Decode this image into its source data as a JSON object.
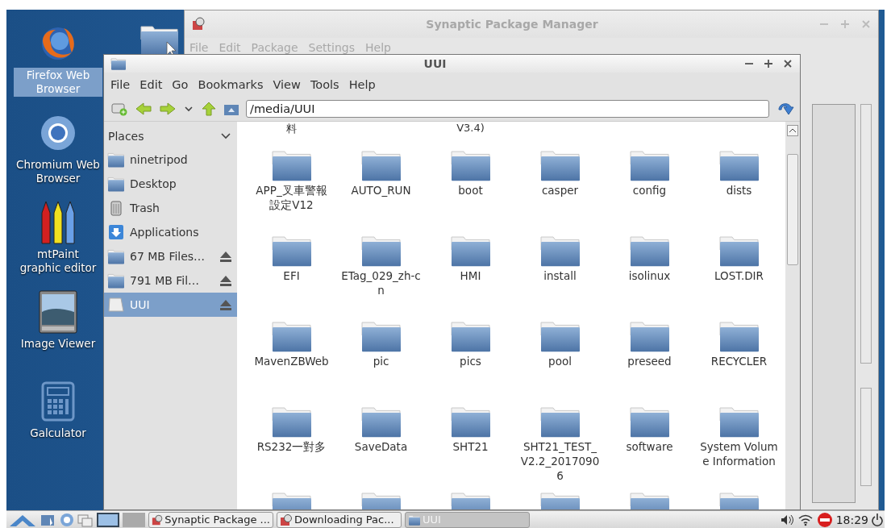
{
  "desktop_icons": [
    {
      "kind": "firefox",
      "label": "Firefox Web Browser",
      "selected": true
    },
    {
      "kind": "chromium",
      "label": "Chromium Web Browser",
      "selected": false
    },
    {
      "kind": "paint",
      "label": "mtPaint graphic editor",
      "selected": false
    },
    {
      "kind": "image-viewer",
      "label": "Image Viewer",
      "selected": false
    },
    {
      "kind": "calculator",
      "label": "Galculator",
      "selected": false
    }
  ],
  "background_window": {
    "title": "Synaptic Package Manager",
    "menu": [
      "File",
      "Edit",
      "Package",
      "Settings",
      "Help"
    ]
  },
  "file_manager": {
    "title": "UUI",
    "menu": [
      "File",
      "Edit",
      "Go",
      "Bookmarks",
      "View",
      "Tools",
      "Help"
    ],
    "path": "/media/UUI",
    "places_header": "Places",
    "places": [
      {
        "kind": "folder",
        "label": "ninetripod",
        "ejectable": false,
        "selected": false
      },
      {
        "kind": "folder",
        "label": "Desktop",
        "ejectable": false,
        "selected": false
      },
      {
        "kind": "trash",
        "label": "Trash",
        "ejectable": false,
        "selected": false
      },
      {
        "kind": "applications",
        "label": "Applications",
        "ejectable": false,
        "selected": false
      },
      {
        "kind": "folder",
        "label": "67 MB Files…",
        "ejectable": true,
        "selected": false
      },
      {
        "kind": "folder",
        "label": "791 MB Fil…",
        "ejectable": true,
        "selected": false
      },
      {
        "kind": "drive",
        "label": "UUI",
        "ejectable": true,
        "selected": true
      }
    ],
    "labels_above": [
      "料",
      "V3.4)"
    ],
    "folders": [
      {
        "name": "APP_叉車警報設定V12"
      },
      {
        "name": "AUTO_RUN"
      },
      {
        "name": "boot"
      },
      {
        "name": "casper"
      },
      {
        "name": "config"
      },
      {
        "name": "dists"
      },
      {
        "name": "EFI"
      },
      {
        "name": "ETag_029_zh-cn"
      },
      {
        "name": "HMI"
      },
      {
        "name": "install"
      },
      {
        "name": "isolinux"
      },
      {
        "name": "LOST.DIR"
      },
      {
        "name": "MavenZBWeb"
      },
      {
        "name": "pic"
      },
      {
        "name": "pics"
      },
      {
        "name": "pool"
      },
      {
        "name": "preseed"
      },
      {
        "name": "RECYCLER"
      },
      {
        "name": "RS232一對多"
      },
      {
        "name": "SaveData"
      },
      {
        "name": "SHT21"
      },
      {
        "name": "SHT21_TEST_V2.2_20170906"
      },
      {
        "name": "software"
      },
      {
        "name": "System Volume Information"
      }
    ]
  },
  "taskbar": {
    "workspaces": [
      {
        "selected": true
      },
      {
        "selected": false
      }
    ],
    "tasks": [
      {
        "kind": "synaptic",
        "label": "Synaptic Package ...",
        "selected": false
      },
      {
        "kind": "synaptic",
        "label": "Downloading Pac...",
        "selected": false
      },
      {
        "kind": "folder",
        "label": "UUI",
        "selected": true
      }
    ],
    "clock": "18:29"
  }
}
